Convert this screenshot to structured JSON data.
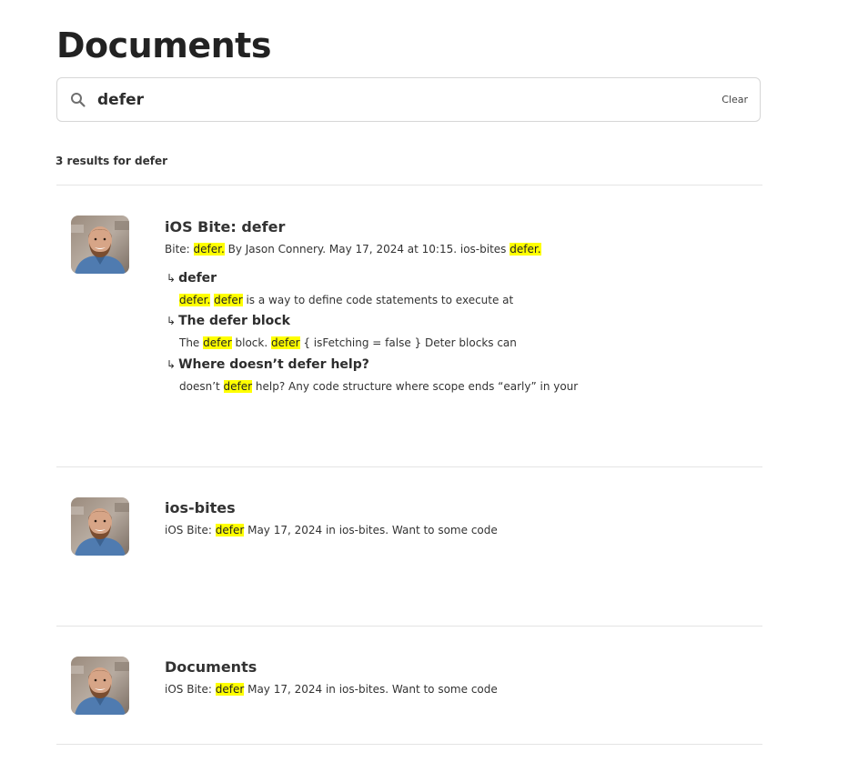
{
  "page": {
    "title": "Documents"
  },
  "search": {
    "query": "defer",
    "placeholder": "",
    "clear_label": "Clear"
  },
  "results_summary": "3 results for defer",
  "results": [
    {
      "title": "iOS Bite: defer",
      "snippet": [
        {
          "t": "Bite: "
        },
        {
          "t": "defer.",
          "hl": true
        },
        {
          "t": " By Jason Connery. May 17, 2024 at 10:15. ios-bites "
        },
        {
          "t": "defer.",
          "hl": true
        }
      ],
      "sub_results": [
        {
          "heading": "defer",
          "snippet": [
            {
              "t": "defer.",
              "hl": true
            },
            {
              "t": " "
            },
            {
              "t": "defer",
              "hl": true
            },
            {
              "t": " is a way to define code statements to execute at"
            }
          ]
        },
        {
          "heading": "The defer block",
          "snippet": [
            {
              "t": "The "
            },
            {
              "t": "defer",
              "hl": true
            },
            {
              "t": " block. "
            },
            {
              "t": "defer",
              "hl": true
            },
            {
              "t": " { isFetching = false } Deter blocks can"
            }
          ]
        },
        {
          "heading": "Where doesn’t defer help?",
          "snippet": [
            {
              "t": "doesn’t "
            },
            {
              "t": "defer",
              "hl": true
            },
            {
              "t": " help? Any code structure where scope ends “early” in your"
            }
          ]
        }
      ]
    },
    {
      "title": "ios-bites",
      "snippet": [
        {
          "t": "iOS Bite: "
        },
        {
          "t": "defer",
          "hl": true
        },
        {
          "t": " May 17, 2024 in ios-bites. Want to some code"
        }
      ]
    },
    {
      "title": "Documents",
      "snippet": [
        {
          "t": "iOS Bite: "
        },
        {
          "t": "defer",
          "hl": true
        },
        {
          "t": " May 17, 2024 in ios-bites. Want to some code"
        }
      ]
    }
  ],
  "sub_result_arrow": "↳",
  "colors": {
    "highlight": "#ffff00",
    "text": "#333333",
    "divider": "#e4e4e4",
    "border": "#d6d6d6"
  },
  "icons": {
    "search": "search-icon",
    "avatar": "author-avatar"
  }
}
